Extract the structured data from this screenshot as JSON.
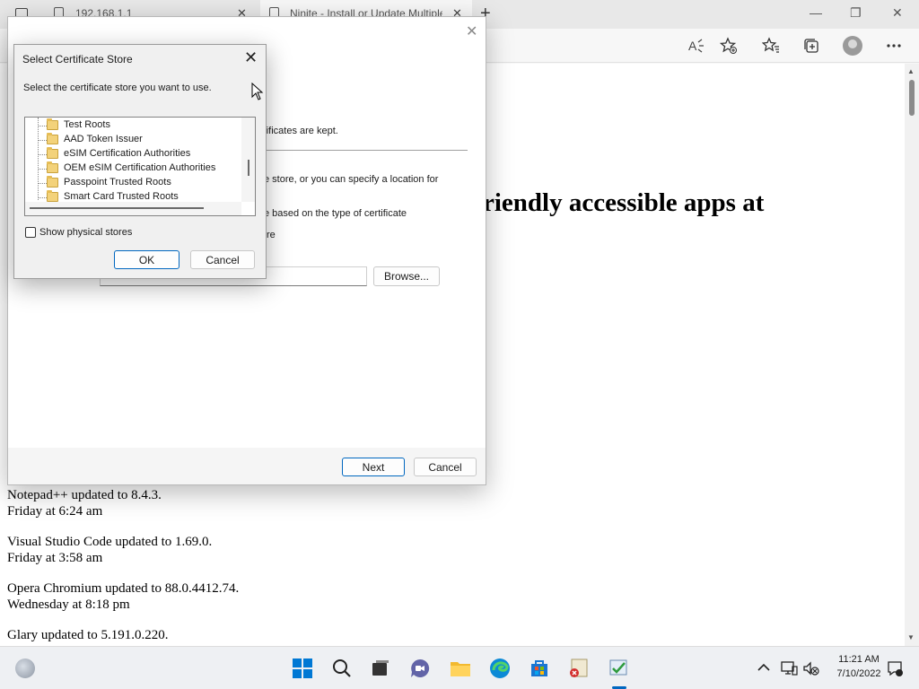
{
  "browser": {
    "tabs": [
      {
        "title": "192.168.1.1",
        "close": "✕"
      },
      {
        "title": "Ninite - Install or Update Multiple",
        "close": "✕"
      }
    ],
    "new_tab": "+",
    "window_controls": {
      "minimize": "—",
      "maximize": "❐",
      "close": "✕"
    }
  },
  "page": {
    "heading": "riendly accessible apps at",
    "updates": [
      {
        "line1": "Notepad++ updated to 8.4.3.",
        "line2": "Friday at 6:24 am"
      },
      {
        "line1": "Visual Studio Code updated to 1.69.0.",
        "line2": "Friday at 3:58 am"
      },
      {
        "line1": "Opera Chromium updated to 88.0.4412.74.",
        "line2": "Wednesday at 8:18 pm"
      },
      {
        "line1": "Glary updated to 5.191.0.220.",
        "line2": ""
      }
    ]
  },
  "wizard": {
    "close": "✕",
    "text_kept": "rtificates are kept.",
    "text_store": "e store, or you can specify a location for",
    "text_based": "e based on the type of certificate",
    "text_re": "re",
    "browse_label": "Browse...",
    "next_label": "Next",
    "cancel_label": "Cancel"
  },
  "store_dialog": {
    "title": "Select Certificate Store",
    "close": "✕",
    "instruction": "Select the certificate store you want to use.",
    "items": [
      "Test Roots",
      "AAD Token Issuer",
      "eSIM Certification Authorities",
      "OEM eSIM Certification Authorities",
      "Passpoint Trusted Roots",
      "Smart Card Trusted Roots"
    ],
    "show_physical_label": "Show physical stores",
    "ok_label": "OK",
    "cancel_label": "Cancel"
  },
  "taskbar": {
    "time": "11:21 AM",
    "date": "7/10/2022"
  }
}
